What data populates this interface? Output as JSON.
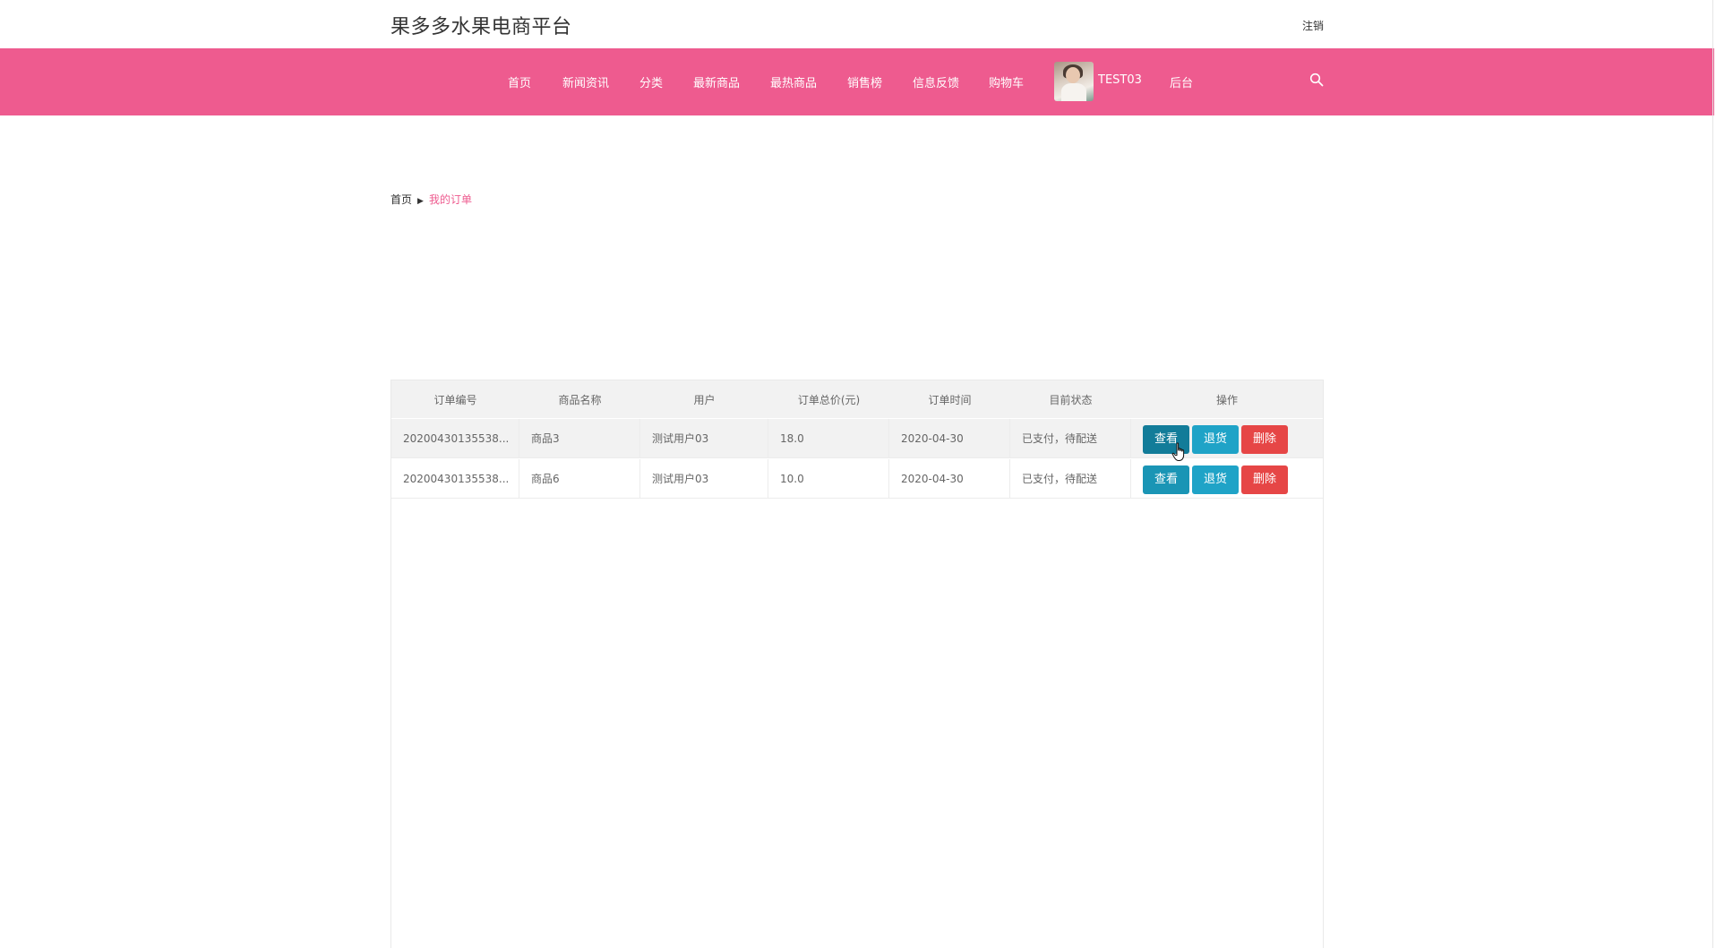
{
  "header": {
    "site_title": "果多多水果电商平台",
    "logout_label": "注销"
  },
  "nav": {
    "items": [
      "首页",
      "新闻资讯",
      "分类",
      "最新商品",
      "最热商品",
      "销售榜",
      "信息反馈",
      "购物车"
    ],
    "username": "TEST03",
    "admin_label": "后台",
    "accent_color": "#ee5b8f"
  },
  "breadcrumb": {
    "home": "首页",
    "separator": "▶",
    "current": "我的订单"
  },
  "orders": {
    "columns": [
      "订单编号",
      "商品名称",
      "用户",
      "订单总价(元)",
      "订单时间",
      "目前状态",
      "操作"
    ],
    "rows": [
      {
        "id": "20200430135538...",
        "product": "商品3",
        "user": "测试用户03",
        "total": "18.0",
        "time": "2020-04-30",
        "status": "已支付，待配送"
      },
      {
        "id": "20200430135538...",
        "product": "商品6",
        "user": "测试用户03",
        "total": "10.0",
        "time": "2020-04-30",
        "status": "已支付，待配送"
      }
    ],
    "actions": {
      "view": "查看",
      "return": "退货",
      "delete": "删除"
    }
  },
  "icons": {
    "search": "search-icon",
    "cursor": "hand-cursor-icon"
  }
}
